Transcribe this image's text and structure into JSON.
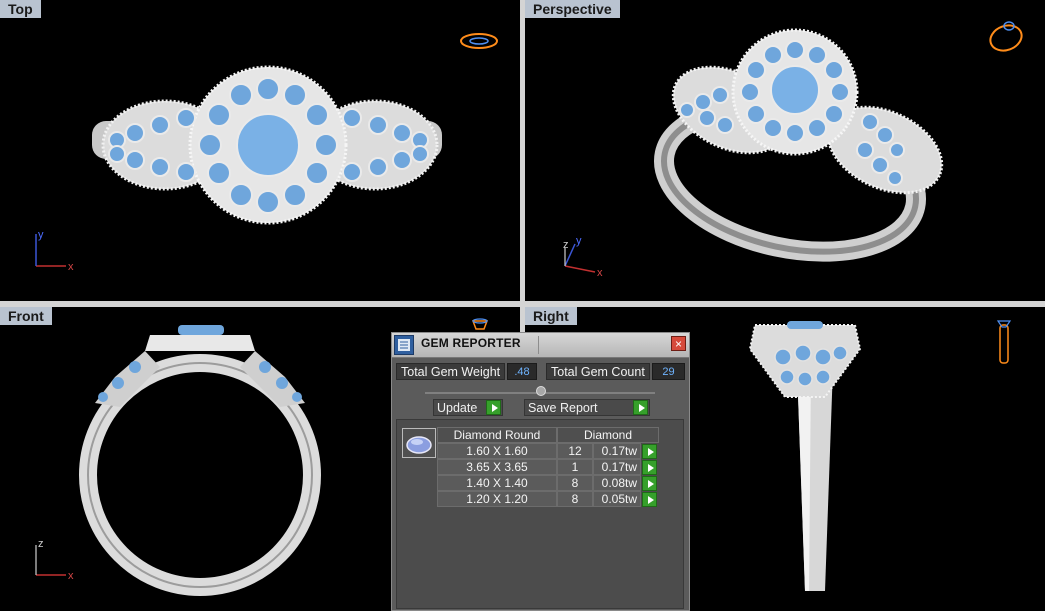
{
  "viewports": {
    "top": {
      "label": "Top"
    },
    "perspective": {
      "label": "Perspective"
    },
    "front": {
      "label": "Front"
    },
    "right": {
      "label": "Right"
    }
  },
  "axes": {
    "top": {
      "vertical": "y",
      "horizontal": "x"
    },
    "perspective": {
      "z": "z",
      "y": "y",
      "x": "x"
    },
    "front": {
      "vertical": "z",
      "horizontal": "x"
    }
  },
  "colors": {
    "gem": "#6fa6dc",
    "metal": "#d0d0d0",
    "viewport_bg": "#000000",
    "label_bg": "#b9c3d0",
    "nav_icon": "#ff8c1a",
    "panel_bg": "#5b5b5b",
    "accent_green": "#36a02b",
    "value_text": "#6fb4ff"
  },
  "icons": {
    "navigation": "ring-nav-icon",
    "close": "close-icon",
    "play": "play-arrow-icon",
    "gem": "gem-icon"
  },
  "gem_reporter": {
    "title": "GEM REPORTER",
    "close_symbol": "×",
    "total_weight_label": "Total Gem Weight",
    "total_weight_value": ".48",
    "total_count_label": "Total Gem Count",
    "total_count_value": "29",
    "update_label": "Update",
    "save_report_label": "Save Report",
    "table_headers": [
      "Diamond Round",
      "Diamond"
    ],
    "rows": [
      {
        "size": "1.60 X 1.60",
        "count": "12",
        "weight": "0.17tw"
      },
      {
        "size": "3.65 X 3.65",
        "count": "1",
        "weight": "0.17tw"
      },
      {
        "size": "1.40 X 1.40",
        "count": "8",
        "weight": "0.08tw"
      },
      {
        "size": "1.20 X 1.20",
        "count": "8",
        "weight": "0.05tw"
      }
    ]
  }
}
